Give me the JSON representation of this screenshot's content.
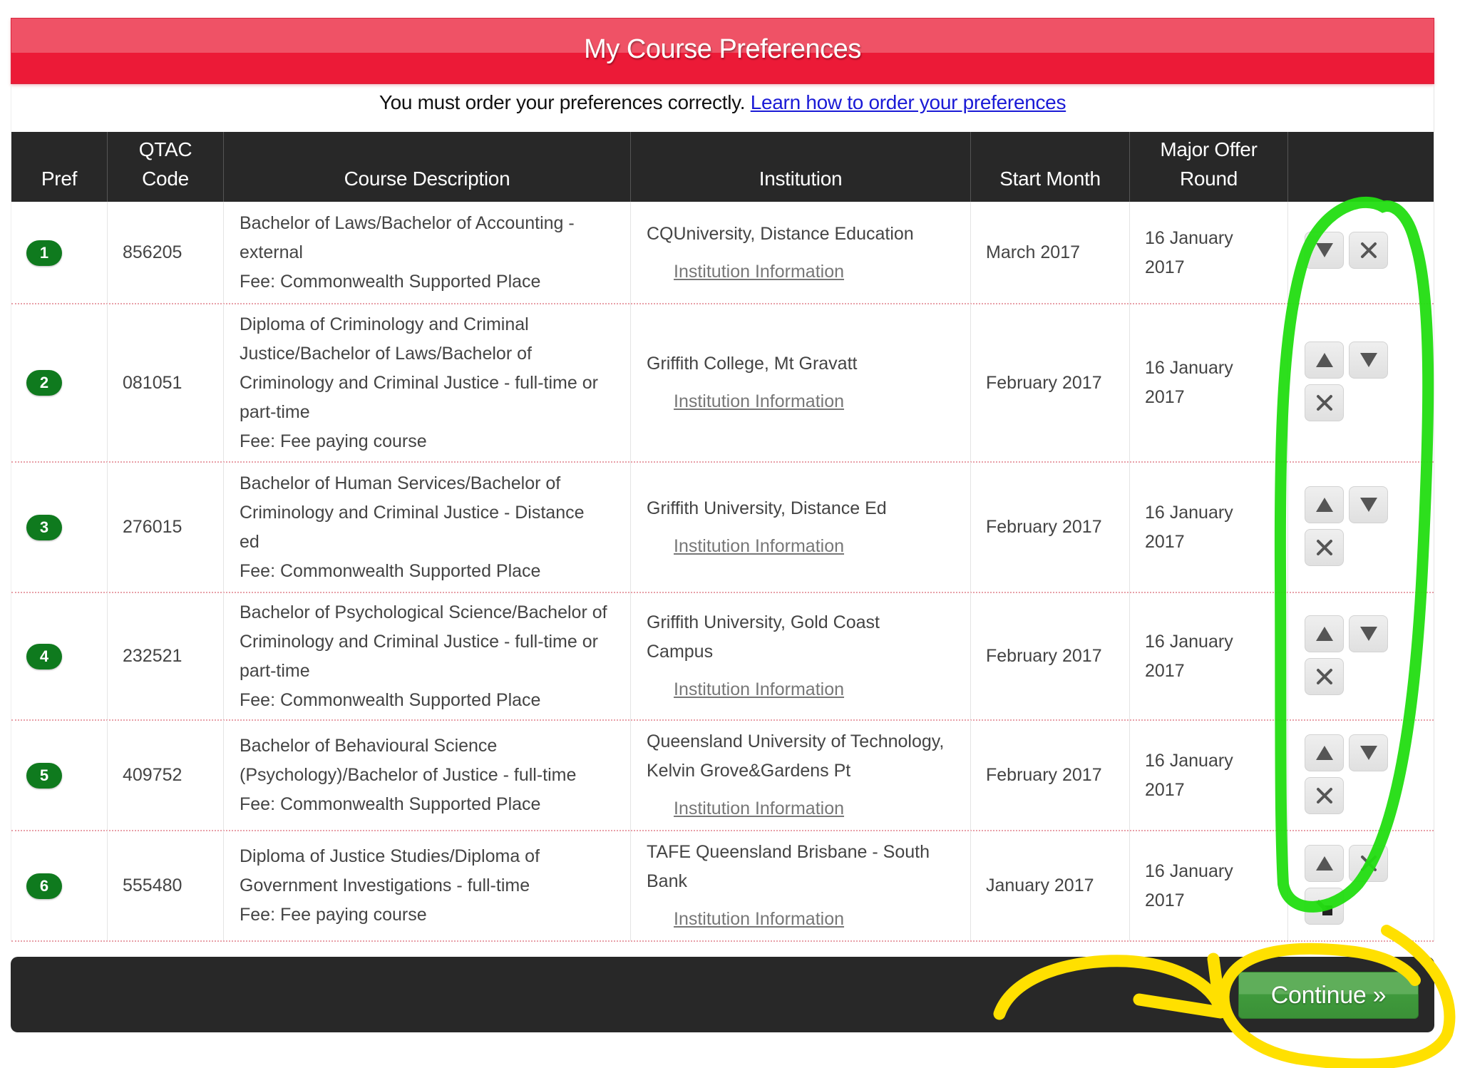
{
  "page": {
    "title": "My Course Preferences",
    "notice_text": "You must order your preferences correctly.",
    "notice_link": "Learn how to order your preferences"
  },
  "colors": {
    "title_bar": "#ec1a37",
    "badge": "#0f7a1e",
    "continue_button": "#3f9a3c",
    "header_bg": "#282828",
    "link": "#1a1ad6",
    "annotation_green": "#22dd11",
    "annotation_yellow": "#ffe000"
  },
  "table": {
    "headers": {
      "pref": "Pref",
      "qtac_code_line1": "QTAC",
      "qtac_code_line2": "Code",
      "course_description": "Course Description",
      "institution": "Institution",
      "start_month": "Start Month",
      "major_offer_line1": "Major Offer",
      "major_offer_line2": "Round",
      "actions": ""
    },
    "institution_link_label": "Institution Information",
    "rows": [
      {
        "pref": "1",
        "code": "856205",
        "description_lines": [
          "Bachelor of Laws/Bachelor of Accounting -",
          "external"
        ],
        "fee": "Fee: Commonwealth Supported Place",
        "institution_lines": [
          "CQUniversity, Distance Education"
        ],
        "start_month": "March 2017",
        "offer_round_lines": [
          "16 January",
          "2017"
        ],
        "actions": [
          "move-down",
          "remove"
        ]
      },
      {
        "pref": "2",
        "code": "081051",
        "description_lines": [
          "Diploma of Criminology and Criminal",
          "Justice/Bachelor of Laws/Bachelor of",
          "Criminology and Criminal Justice - full-time or",
          "part-time"
        ],
        "fee": "Fee: Fee paying course",
        "institution_lines": [
          "Griffith College, Mt Gravatt"
        ],
        "start_month": "February 2017",
        "offer_round_lines": [
          "16 January",
          "2017"
        ],
        "actions": [
          "move-up",
          "move-down",
          "remove"
        ]
      },
      {
        "pref": "3",
        "code": "276015",
        "description_lines": [
          "Bachelor of Human Services/Bachelor of",
          "Criminology and Criminal Justice - Distance",
          "ed"
        ],
        "fee": "Fee: Commonwealth Supported Place",
        "institution_lines": [
          "Griffith University, Distance Ed"
        ],
        "start_month": "February 2017",
        "offer_round_lines": [
          "16 January",
          "2017"
        ],
        "actions": [
          "move-up",
          "move-down",
          "remove"
        ]
      },
      {
        "pref": "4",
        "code": "232521",
        "description_lines": [
          "Bachelor of Psychological Science/Bachelor of",
          "Criminology and Criminal Justice - full-time or",
          "part-time"
        ],
        "fee": "Fee: Commonwealth Supported Place",
        "institution_lines": [
          "Griffith University, Gold Coast",
          "Campus"
        ],
        "start_month": "February 2017",
        "offer_round_lines": [
          "16 January",
          "2017"
        ],
        "actions": [
          "move-up",
          "move-down",
          "remove"
        ]
      },
      {
        "pref": "5",
        "code": "409752",
        "description_lines": [
          "Bachelor of Behavioural Science",
          "(Psychology)/Bachelor of Justice - full-time"
        ],
        "fee": "Fee: Commonwealth Supported Place",
        "institution_lines": [
          "Queensland University of Technology,",
          "Kelvin Grove&Gardens Pt"
        ],
        "start_month": "February 2017",
        "offer_round_lines": [
          "16 January",
          "2017"
        ],
        "actions": [
          "move-up",
          "move-down",
          "remove"
        ]
      },
      {
        "pref": "6",
        "code": "555480",
        "description_lines": [
          "Diploma of Justice Studies/Diploma of",
          "Government Investigations - full-time"
        ],
        "fee": "Fee: Fee paying course",
        "institution_lines": [
          "TAFE Queensland Brisbane - South",
          "Bank"
        ],
        "start_month": "January 2017",
        "offer_round_lines": [
          "16 January",
          "2017"
        ],
        "actions": [
          "move-up",
          "remove",
          "edit"
        ]
      }
    ]
  },
  "footer": {
    "continue_label": "Continue »"
  },
  "icons": {
    "move-up": "triangle-up-icon",
    "move-down": "triangle-down-icon",
    "remove": "close-x-icon",
    "edit": "pencil-icon"
  }
}
